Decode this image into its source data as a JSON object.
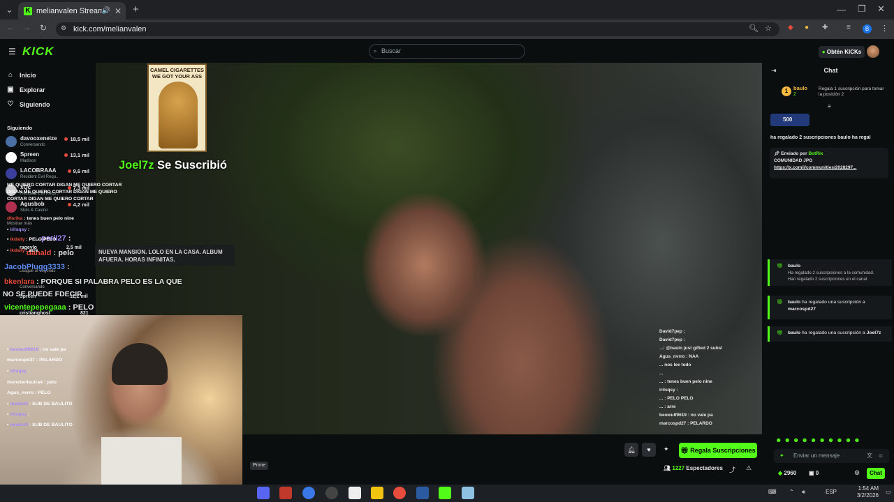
{
  "browser": {
    "tab_title": "melianvalen Stream - Watch",
    "url": "kick.com/melianvalen"
  },
  "header": {
    "logo": "KICK",
    "search_placeholder": "Buscar",
    "get_kicks": "Obtén KICKs"
  },
  "sidebar": {
    "nav": [
      {
        "label": "Inicio",
        "icon": "home-icon"
      },
      {
        "label": "Explorar",
        "icon": "compass-icon"
      },
      {
        "label": "Siguiendo",
        "icon": "heart-icon"
      }
    ],
    "following_title": "Siguiendo",
    "following": [
      {
        "name": "davooxeneize",
        "category": "Conversando",
        "viewers": "18,5 mil",
        "color": "#4a6fa5"
      },
      {
        "name": "Spreen",
        "category": "Madison",
        "viewers": "13,1 mil",
        "color": "#ffffff"
      },
      {
        "name": "LACOBRAAA",
        "category": "Resident Evil Requ...",
        "viewers": "9,6 mil",
        "color": "#3a3f9e"
      },
      {
        "name": "xQc",
        "category": "Resident Evil Requ...",
        "viewers": "7,3 mil",
        "color": "#cccccc"
      },
      {
        "name": "Agusbob",
        "category": "Slots & Casino",
        "viewers": "4,2 mil",
        "color": "#b03050"
      }
    ],
    "show_more": "Mostrar más",
    "partial_items": [
      {
        "name": "rageylo",
        "viewers": "2,5 mil"
      },
      {
        "name": "League of Legends",
        "viewers": ""
      },
      {
        "name": "Conversando",
        "viewers": ""
      },
      {
        "name": "Spreen",
        "viewers": "12,2 mil"
      },
      {
        "name": "cristianghost",
        "viewers": "821"
      }
    ]
  },
  "stream": {
    "poster_text": "CAMEL CIGARETTES WE GOT YOUR ASS",
    "sub_alert_user": "Joel7z",
    "sub_alert_text": " Se Suscribió",
    "info_box": "NUEVA MANSION. LOLO EN LA CASA. ALBUM AFUERA. HORAS INFINITAS.",
    "overlay_lines": [
      {
        "user": "...perii27",
        "text": " :",
        "color": "#a78bfa"
      },
      {
        "user": "danald",
        "text": " : pelo",
        "color": "#e74c3c"
      },
      {
        "user": "JacobPlugg3333",
        "text": " :",
        "color": "#5b8def"
      },
      {
        "user": "bkenlara",
        "text": " : PORQUE SI PALABRA PELO ES LA QUE",
        "color": "#e74c3c"
      },
      {
        "user": "",
        "text": "NO SE PUEDE FDECIR",
        "color": "#ffffff"
      },
      {
        "user": "vicentepepegaaa",
        "text": " : PELO",
        "color": "#53fc18"
      }
    ],
    "mini_chat": [
      "David7pep :",
      "David7pep :",
      "...: @baulo just gifted 2 subs!",
      "Agus_nvrro : NAA",
      "... nos lee todo",
      "...",
      "... : tenes buen pelo nine",
      "irilsqsy :",
      "... : PELO PELO",
      "... : arre",
      "beowulf9619 : no vale pa",
      "marcospd27 : PELARDO",
      "..."
    ],
    "prime": "Prime",
    "gift_button": "Regala Suscripciones",
    "viewers_count": "1227",
    "viewers_label": "Espectadores"
  },
  "chat": {
    "title": "Chat",
    "top_gifter": {
      "name": "baulo",
      "count": "2",
      "text": "Regala 1 suscripción para tomar la posición 2"
    },
    "kicks_badge": "500",
    "ticker": "ha regalado 2 suscripciones   baulo ha regal",
    "pinned": {
      "sent_by": "Enviado por",
      "bot": "BotRix",
      "title": "COMUNIDAD JPG",
      "link": "https://x.com/i/communities/2028297..."
    },
    "messages": [
      {
        "user": "",
        "text": "ME QUIERO CORTAR DIGAN ME QUIERO CORTAR DIGAN ME QUIERO CORTAR DIGAN ME QUIERO CORTAR DIGAN ME QUIERO CORTAR",
        "color": "#ffffff"
      },
      {
        "user": "dfarika",
        "text": ": tenes buen pelo nine",
        "color": "#e74c3c"
      },
      {
        "user": "irilsqsy",
        "text": ":",
        "color": "#a78bfa"
      },
      {
        "user": "ikdaily",
        "text": ": PELO PELO",
        "color": "#e74c3c"
      },
      {
        "user": "ikdaily",
        "text": ": arre",
        "color": "#e74c3c"
      }
    ],
    "gift1": {
      "user": "baulo",
      "line1": "Ha regalado 2 suscripciones a la comunidad.",
      "line2": "Han regalado 2 suscripciones en el canal."
    },
    "gift2": {
      "user": "baulo",
      "text": "ha regalado una suscripción a",
      "target": "marcospd27"
    },
    "gift3": {
      "user": "baulo",
      "text": "ha regalado una suscripción a",
      "target": "Joel7z"
    },
    "messages2": [
      {
        "user": "beowulf9619",
        "text": ": no vale pa",
        "color": "#a78bfa"
      },
      {
        "user": "marcospd27",
        "text": ": PELARDO",
        "color": "#ffffff"
      },
      {
        "user": "irilsqsy",
        "text": ":",
        "color": "#a78bfa"
      },
      {
        "user": "monster4sutra4",
        "text": ": pelo",
        "color": "#ffffff"
      },
      {
        "user": "Agus_nvrro",
        "text": ": PELO",
        "color": "#ffffff"
      },
      {
        "user": "maxkrill",
        "text": ": SUB DE BAULITO",
        "color": "#a78bfa"
      },
      {
        "user": "irilsqsy",
        "text": ":",
        "color": "#a78bfa"
      },
      {
        "user": "maxkrill",
        "text": ": SUB DE BAULITO",
        "color": "#a78bfa"
      }
    ],
    "input_placeholder": "Enviar un mensaje",
    "kicks_balance": "2960",
    "sub_count": "0",
    "send_button": "Chat"
  },
  "taskbar": {
    "lang": "ESP",
    "time": "1:54 AM",
    "date": "3/2/2026"
  },
  "colors": {
    "accent": "#53fc18",
    "background": "#0b0e0f"
  }
}
